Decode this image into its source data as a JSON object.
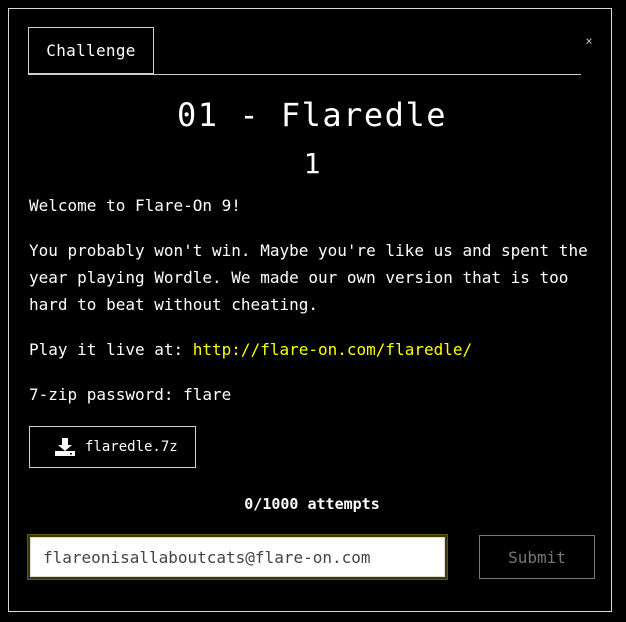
{
  "tabs": {
    "challenge_label": "Challenge"
  },
  "close": {
    "glyph": "×"
  },
  "challenge": {
    "title": "01 - Flaredle",
    "points": "1",
    "intro": "Welcome to Flare-On 9!",
    "description": "You probably won't win. Maybe you're like us and spent the year playing Wordle. We made our own version that is too hard to beat without cheating.",
    "play_prefix": "Play it live at: ",
    "play_link": "http://flare-on.com/flaredle/",
    "password": "7-zip password: flare"
  },
  "download": {
    "icon": "download-icon",
    "filename": "flaredle.7z"
  },
  "attempts": {
    "text": "0/1000 attempts"
  },
  "answer": {
    "value": "flareonisallaboutcats@flare-on.com"
  },
  "submit": {
    "label": "Submit"
  },
  "colors": {
    "background": "#000000",
    "text": "#ffffff",
    "link": "#ffff00",
    "input_focus_ring": "#3a3a00",
    "disabled": "#777777"
  }
}
